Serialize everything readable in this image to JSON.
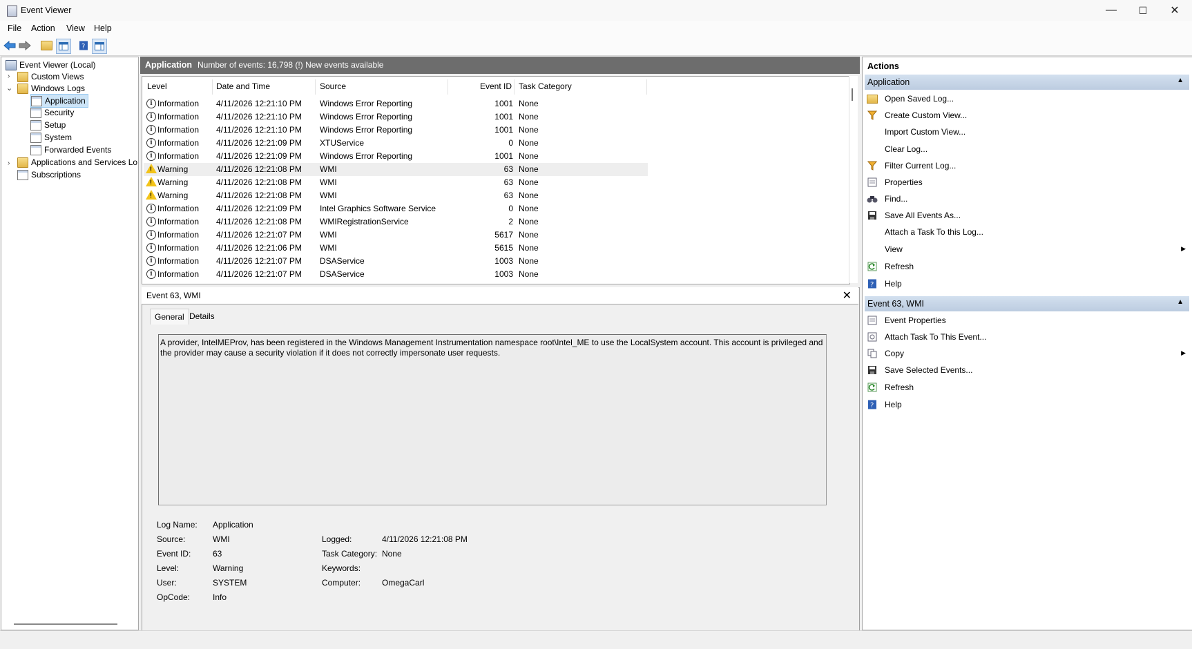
{
  "window": {
    "title": "Event Viewer",
    "controls": {
      "minimize": "—",
      "maximize": "☐",
      "close": "✕"
    }
  },
  "menu": [
    "File",
    "Action",
    "View",
    "Help"
  ],
  "tree": {
    "root": "Event Viewer (Local)",
    "custom_views": "Custom Views",
    "windows_logs": "Windows Logs",
    "logs": [
      "Application",
      "Security",
      "Setup",
      "System",
      "Forwarded Events"
    ],
    "app_services": "Applications and Services Lo",
    "subscriptions": "Subscriptions"
  },
  "header": {
    "log_name": "Application",
    "summary": "Number of events: 16,798 (!) New events available"
  },
  "columns": [
    "Level",
    "Date and Time",
    "Source",
    "Event ID",
    "Task Category"
  ],
  "events": [
    {
      "level": "Information",
      "date": "4/11/2026 12:21:10 PM",
      "source": "Windows Error Reporting",
      "id": "1001",
      "category": "None"
    },
    {
      "level": "Information",
      "date": "4/11/2026 12:21:10 PM",
      "source": "Windows Error Reporting",
      "id": "1001",
      "category": "None"
    },
    {
      "level": "Information",
      "date": "4/11/2026 12:21:10 PM",
      "source": "Windows Error Reporting",
      "id": "1001",
      "category": "None"
    },
    {
      "level": "Information",
      "date": "4/11/2026 12:21:09 PM",
      "source": "XTUService",
      "id": "0",
      "category": "None"
    },
    {
      "level": "Information",
      "date": "4/11/2026 12:21:09 PM",
      "source": "Windows Error Reporting",
      "id": "1001",
      "category": "None"
    },
    {
      "level": "Warning",
      "date": "4/11/2026 12:21:08 PM",
      "source": "WMI",
      "id": "63",
      "category": "None"
    },
    {
      "level": "Warning",
      "date": "4/11/2026 12:21:08 PM",
      "source": "WMI",
      "id": "63",
      "category": "None"
    },
    {
      "level": "Warning",
      "date": "4/11/2026 12:21:08 PM",
      "source": "WMI",
      "id": "63",
      "category": "None"
    },
    {
      "level": "Information",
      "date": "4/11/2026 12:21:09 PM",
      "source": "Intel Graphics Software Service",
      "id": "0",
      "category": "None"
    },
    {
      "level": "Information",
      "date": "4/11/2026 12:21:08 PM",
      "source": "WMIRegistrationService",
      "id": "2",
      "category": "None"
    },
    {
      "level": "Information",
      "date": "4/11/2026 12:21:07 PM",
      "source": "WMI",
      "id": "5617",
      "category": "None"
    },
    {
      "level": "Information",
      "date": "4/11/2026 12:21:06 PM",
      "source": "WMI",
      "id": "5615",
      "category": "None"
    },
    {
      "level": "Information",
      "date": "4/11/2026 12:21:07 PM",
      "source": "DSAService",
      "id": "1003",
      "category": "None"
    },
    {
      "level": "Information",
      "date": "4/11/2026 12:21:07 PM",
      "source": "DSAService",
      "id": "1003",
      "category": "None"
    }
  ],
  "detail": {
    "title": "Event 63, WMI",
    "close": "✕",
    "tabs": [
      "General",
      "Details"
    ],
    "description": "A provider, IntelMEProv, has been registered in the Windows Management Instrumentation namespace root\\Intel_ME to use the LocalSystem account. This account is privileged and the provider may cause a security violation if it does not correctly impersonate user requests.",
    "labels": {
      "log_name": "Log Name:",
      "source": "Source:",
      "event_id": "Event ID:",
      "level": "Level:",
      "user": "User:",
      "opcode": "OpCode:",
      "logged": "Logged:",
      "task_category": "Task Category:",
      "keywords": "Keywords:",
      "computer": "Computer:"
    },
    "values": {
      "log_name": "Application",
      "source": "WMI",
      "event_id": "63",
      "level": "Warning",
      "user": "SYSTEM",
      "opcode": "Info",
      "logged": "4/11/2026 12:21:08 PM",
      "task_category": "None",
      "keywords": "",
      "computer": "OmegaCarl"
    }
  },
  "actions": {
    "title": "Actions",
    "section1": "Application",
    "items1": [
      {
        "label": "Open Saved Log...",
        "icon": "folder-open-icon"
      },
      {
        "label": "Create Custom View...",
        "icon": "filter-icon"
      },
      {
        "label": "Import Custom View...",
        "icon": ""
      },
      {
        "label": "Clear Log...",
        "icon": ""
      },
      {
        "label": "Filter Current Log...",
        "icon": "filter-icon"
      },
      {
        "label": "Properties",
        "icon": "properties-icon"
      },
      {
        "label": "Find...",
        "icon": "binoculars-icon"
      },
      {
        "label": "Save All Events As...",
        "icon": "save-icon"
      },
      {
        "label": "Attach a Task To this Log...",
        "icon": ""
      },
      {
        "label": "View",
        "icon": "",
        "submenu": true
      },
      {
        "label": "Refresh",
        "icon": "refresh-icon"
      },
      {
        "label": "Help",
        "icon": "help-icon"
      }
    ],
    "section2": "Event 63, WMI",
    "items2": [
      {
        "label": "Event Properties",
        "icon": "properties-icon"
      },
      {
        "label": "Attach Task To This Event...",
        "icon": "task-icon"
      },
      {
        "label": "Copy",
        "icon": "copy-icon",
        "submenu": true
      },
      {
        "label": "Save Selected Events...",
        "icon": "save-icon"
      },
      {
        "label": "Refresh",
        "icon": "refresh-icon"
      },
      {
        "label": "Help",
        "icon": "help-icon"
      }
    ]
  }
}
